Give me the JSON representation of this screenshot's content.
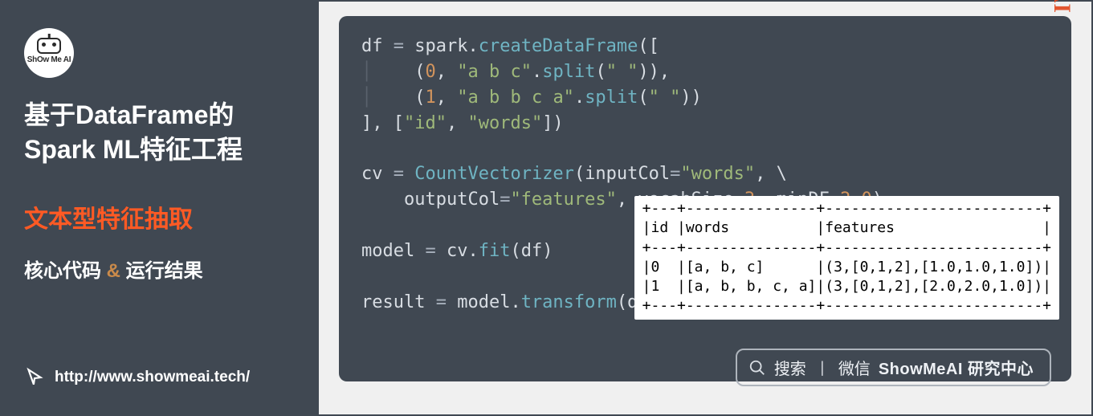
{
  "left": {
    "logo_label": "ShOw Me AI",
    "title_line1": "基于DataFrame的",
    "title_line2": "Spark ML特征工程",
    "subtitle": "文本型特征抽取",
    "meta_prefix": "核心代码 ",
    "meta_amp": "&",
    "meta_suffix": " 运行结果",
    "url": "http://www.showmeai.tech/"
  },
  "code": {
    "l1_a": "df ",
    "l1_b": "=",
    "l1_c": " spark.",
    "l1_d": "createDataFrame",
    "l1_e": "([",
    "l2_a": "    (",
    "l2_b": "0",
    "l2_c": ", ",
    "l2_d": "\"a b c\"",
    "l2_e": ".",
    "l2_f": "split",
    "l2_g": "(",
    "l2_h": "\" \"",
    "l2_i": ")),",
    "l3_a": "    (",
    "l3_b": "1",
    "l3_c": ", ",
    "l3_d": "\"a b b c a\"",
    "l3_e": ".",
    "l3_f": "split",
    "l3_g": "(",
    "l3_h": "\" \"",
    "l3_i": "))",
    "l4_a": "], [",
    "l4_b": "\"id\"",
    "l4_c": ", ",
    "l4_d": "\"words\"",
    "l4_e": "])",
    "l6_a": "cv ",
    "l6_b": "=",
    "l6_c": " ",
    "l6_d": "CountVectorizer",
    "l6_e": "(inputCol",
    "l6_f": "=",
    "l6_g": "\"words\"",
    "l6_h": ", \\",
    "l7_a": "    outputCol",
    "l7_b": "=",
    "l7_c": "\"features\"",
    "l7_d": ", vocabSize",
    "l7_e": "=",
    "l7_f": "3",
    "l7_g": ", minDF",
    "l7_h": "=",
    "l7_i": "2.0",
    "l7_j": ")",
    "l9_a": "model ",
    "l9_b": "=",
    "l9_c": " cv.",
    "l9_d": "fit",
    "l9_e": "(df)",
    "l11_a": "result ",
    "l11_b": "=",
    "l11_c": " model.",
    "l11_d": "transform",
    "l11_e": "(df)"
  },
  "table": {
    "border": "+---+---------------+-------------------------+",
    "header": "|id |words          |features                 |",
    "row1": "|0  |[a, b, c]      |(3,[0,1,2],[1.0,1.0,1.0])|",
    "row2": "|1  |[a, b, b, c, a]|(3,[0,1,2],[2.0,2.0,1.0])|"
  },
  "search": {
    "label1": "搜索",
    "sep": "丨",
    "label2": "微信",
    "brand": "ShowMeAI",
    "suffix": " 研究中心"
  },
  "watermark": "ShowMeAI"
}
